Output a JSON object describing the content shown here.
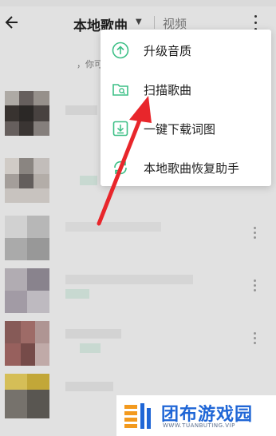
{
  "header": {
    "title": "本地歌曲",
    "caret_icon": "caret-down-icon",
    "tab_video": "视频",
    "back_icon": "back-arrow-icon",
    "more_icon": "more-vertical-icon"
  },
  "list": {
    "hint": "，你可"
  },
  "menu": {
    "items": [
      {
        "label": "升级音质",
        "icon": "upgrade-quality-icon"
      },
      {
        "label": "扫描歌曲",
        "icon": "scan-folder-icon"
      },
      {
        "label": "一键下载词图",
        "icon": "download-icon"
      },
      {
        "label": "本地歌曲恢复助手",
        "icon": "restore-icon"
      }
    ]
  },
  "watermark": {
    "brand": "团布游戏园",
    "domain": "WWW.TUANBUTING.VIP"
  },
  "colors": {
    "accent_green": "#3cbf86",
    "arrow_red": "#e8262b",
    "watermark_blue": "#1f66d6",
    "watermark_orange": "#f39a1e"
  }
}
